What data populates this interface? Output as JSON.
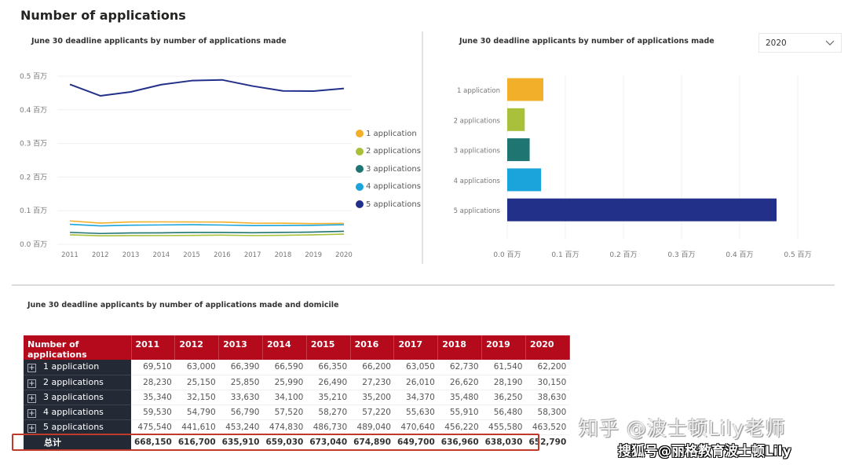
{
  "page": {
    "title": "Number of applications"
  },
  "year_filter": {
    "selected": "2020",
    "icon": "chevron-down-icon"
  },
  "colors": {
    "series": [
      "#F2B02A",
      "#A8C03A",
      "#1E7572",
      "#1BA4DB",
      "#23308A"
    ],
    "table_header": "#B40A1C",
    "row_header": "#232A36",
    "highlight": "#C0392B"
  },
  "chart_data": [
    {
      "type": "line",
      "title": "June 30 deadline applicants by number of applications made",
      "xlabel": "",
      "ylabel": "",
      "x": [
        "2011",
        "2012",
        "2013",
        "2014",
        "2015",
        "2016",
        "2017",
        "2018",
        "2019",
        "2020"
      ],
      "ylim": [
        0,
        0.5
      ],
      "yticks": [
        0.0,
        0.1,
        0.2,
        0.3,
        0.4,
        0.5
      ],
      "ytick_labels": [
        "0.0 百万",
        "0.1 百万",
        "0.2 百万",
        "0.3 百万",
        "0.4 百万",
        "0.5 百万"
      ],
      "y_unit": "millions",
      "grid": true,
      "legend_position": "right",
      "series": [
        {
          "name": "1 application",
          "values": [
            0.06951,
            0.063,
            0.06639,
            0.06659,
            0.06635,
            0.0662,
            0.06305,
            0.06273,
            0.06154,
            0.0622
          ]
        },
        {
          "name": "2 applications",
          "values": [
            0.02823,
            0.02515,
            0.02585,
            0.02599,
            0.02649,
            0.02723,
            0.02601,
            0.02662,
            0.02819,
            0.03015
          ]
        },
        {
          "name": "3 applications",
          "values": [
            0.03534,
            0.03215,
            0.03363,
            0.0341,
            0.03521,
            0.0352,
            0.03437,
            0.03548,
            0.03625,
            0.03863
          ]
        },
        {
          "name": "4 applications",
          "values": [
            0.05953,
            0.05479,
            0.05679,
            0.05752,
            0.05827,
            0.05722,
            0.05563,
            0.05591,
            0.05648,
            0.0583
          ]
        },
        {
          "name": "5 applications",
          "values": [
            0.47554,
            0.44161,
            0.45324,
            0.47483,
            0.48673,
            0.48904,
            0.47064,
            0.45622,
            0.45558,
            0.46352
          ]
        }
      ]
    },
    {
      "type": "bar",
      "orientation": "horizontal",
      "title": "June 30 deadline applicants by number of applications made",
      "categories": [
        "1 application",
        "2 applications",
        "3 applications",
        "4 applications",
        "5 applications"
      ],
      "values": [
        0.0622,
        0.03015,
        0.03863,
        0.0583,
        0.46352
      ],
      "value_unit": "millions",
      "xlim": [
        0,
        0.5
      ],
      "xticks": [
        0.0,
        0.1,
        0.2,
        0.3,
        0.4,
        0.5
      ],
      "xtick_labels": [
        "0.0 百万",
        "0.1 百万",
        "0.2 百万",
        "0.3 百万",
        "0.4 百万",
        "0.5 百万"
      ],
      "grid": true
    },
    {
      "type": "table",
      "title": "June 30 deadline applicants by number of applications made and domicile",
      "columns": [
        "Number of applications",
        "2011",
        "2012",
        "2013",
        "2014",
        "2015",
        "2016",
        "2017",
        "2018",
        "2019",
        "2020"
      ],
      "rows": [
        {
          "label": "1 application",
          "values": [
            "69,510",
            "63,000",
            "66,390",
            "66,590",
            "66,350",
            "66,200",
            "63,050",
            "62,730",
            "61,540",
            "62,200"
          ]
        },
        {
          "label": "2 applications",
          "values": [
            "28,230",
            "25,150",
            "25,850",
            "25,990",
            "26,490",
            "27,230",
            "26,010",
            "26,620",
            "28,190",
            "30,150"
          ]
        },
        {
          "label": "3 applications",
          "values": [
            "35,340",
            "32,150",
            "33,630",
            "34,100",
            "35,210",
            "35,200",
            "34,370",
            "35,480",
            "36,250",
            "38,630"
          ]
        },
        {
          "label": "4 applications",
          "values": [
            "59,530",
            "54,790",
            "56,790",
            "57,520",
            "58,270",
            "57,220",
            "55,630",
            "55,910",
            "56,480",
            "58,300"
          ]
        },
        {
          "label": "5 applications",
          "values": [
            "475,540",
            "441,610",
            "453,240",
            "474,830",
            "486,730",
            "489,040",
            "470,640",
            "456,220",
            "455,580",
            "463,520"
          ]
        }
      ],
      "total": {
        "label": "总计",
        "values": [
          "668,150",
          "616,700",
          "635,910",
          "659,030",
          "673,040",
          "674,890",
          "649,700",
          "636,960",
          "638,030",
          "652,790"
        ]
      }
    }
  ],
  "watermarks": {
    "line1": "知乎 @波士顿Lily老师",
    "line2": "搜狐号@丽格教育波士顿Lily"
  }
}
